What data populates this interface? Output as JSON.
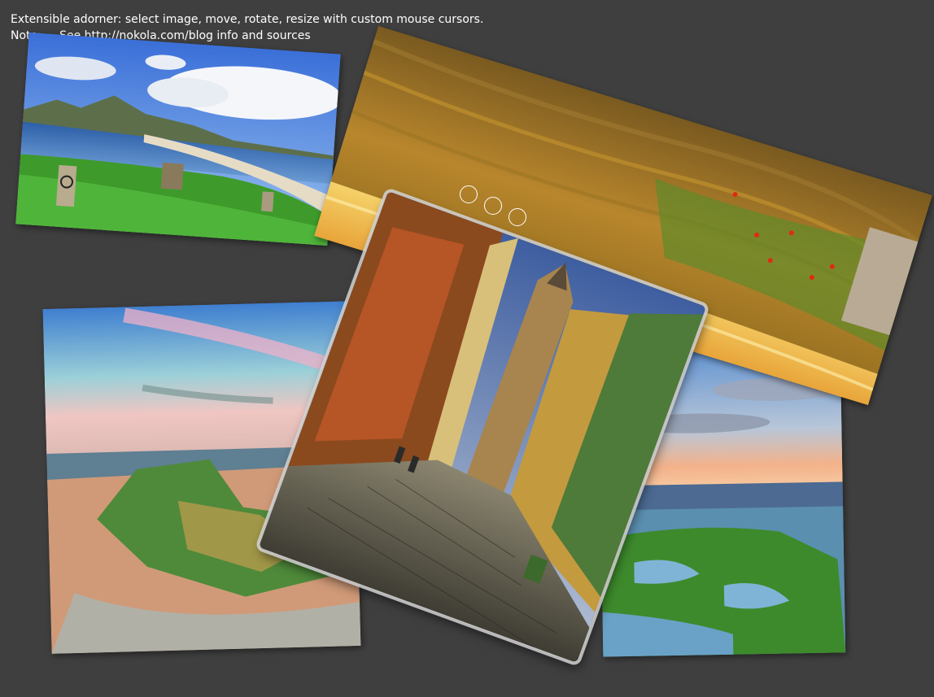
{
  "info": {
    "line1": "Extensible adorner: select image, move, rotate, resize with custom mouse cursors.",
    "line2": "Note: ... See http://nokola.com/blog info and sources"
  },
  "colors": {
    "background": "#3f3f3f",
    "text": "#ffffff",
    "selection_outline": "#d2d2d2"
  },
  "photos": [
    {
      "subject": "coastal bay with hills and grassy cliff",
      "selected": false
    },
    {
      "subject": "golden wheat field with red poppies",
      "selected": false
    },
    {
      "subject": "sandy beach with mossy rocks at sunset",
      "selected": false
    },
    {
      "subject": "rocky shoreline with green algae and tide pools",
      "selected": false
    },
    {
      "subject": "cobblestone street with colorful buildings and tower",
      "selected": true
    }
  ],
  "adorner": {
    "handles": [
      "rotate-handle",
      "resize-handle",
      "move-handle"
    ]
  }
}
